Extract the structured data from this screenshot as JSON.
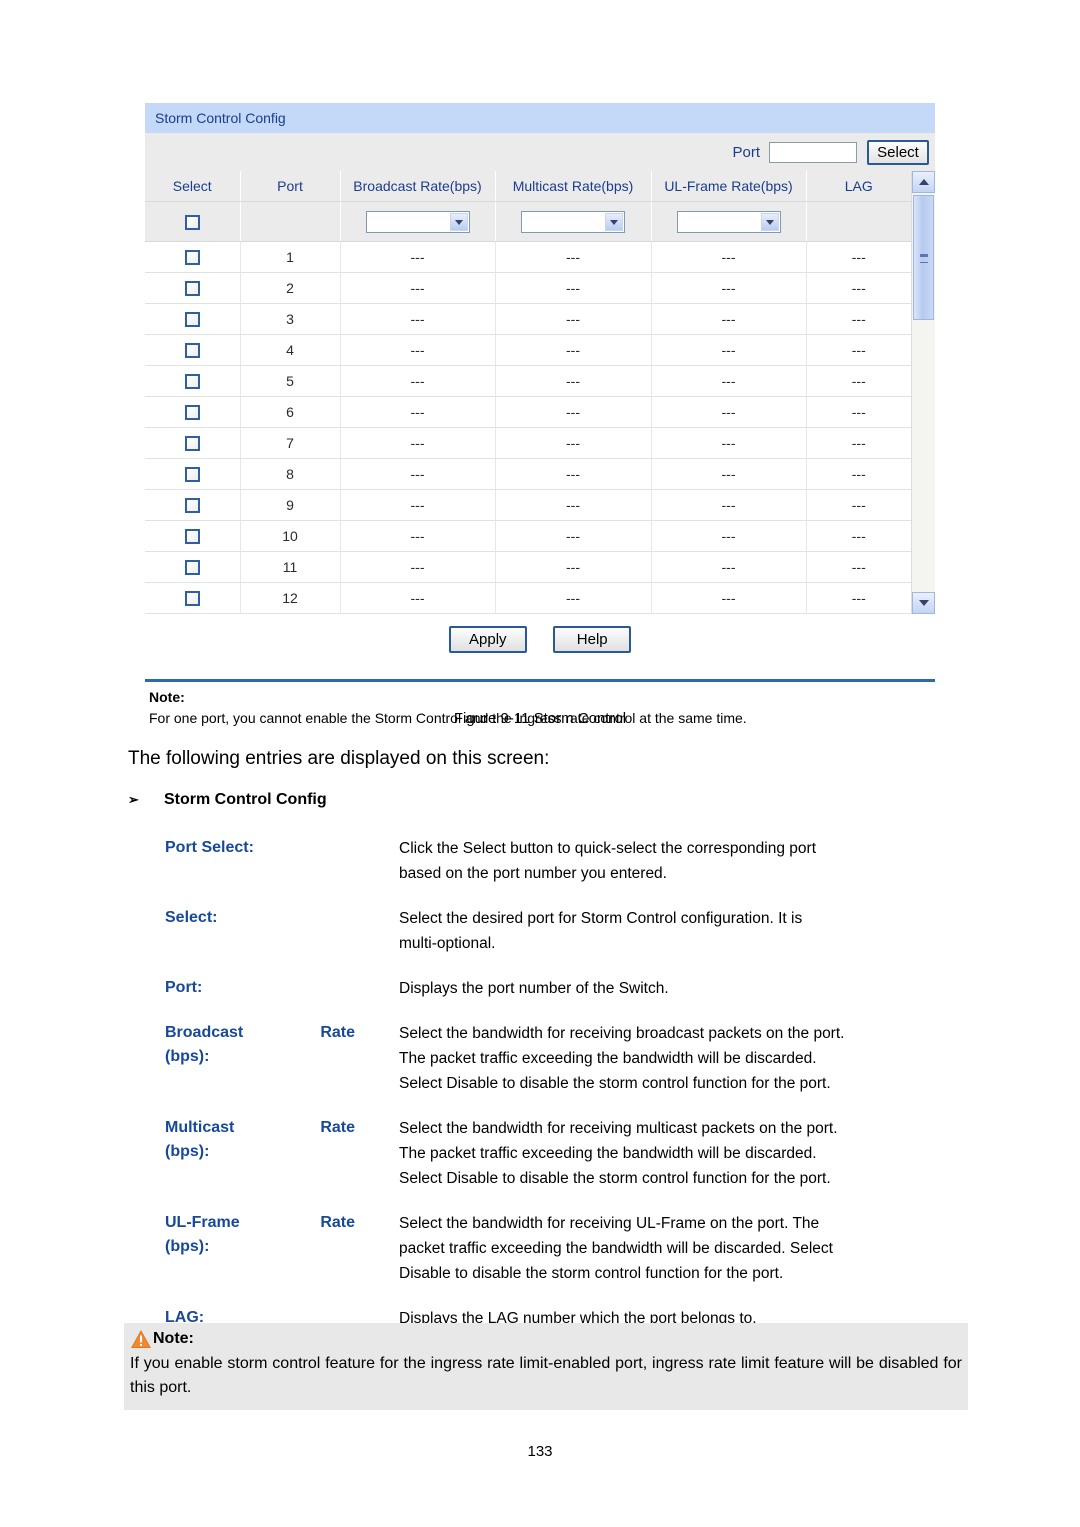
{
  "screenshot": {
    "title": "Storm Control Config",
    "filter": {
      "port_label": "Port",
      "port_value": "",
      "port_placeholder": "",
      "select_button": "Select"
    },
    "columns": [
      "Select",
      "Port",
      "Broadcast Rate(bps)",
      "Multicast Rate(bps)",
      "UL-Frame Rate(bps)",
      "LAG"
    ],
    "filter_row": {
      "checkbox_checked": false,
      "broadcast_rate": "",
      "multicast_rate": "",
      "ul_frame_rate": ""
    },
    "rows": [
      {
        "port": "1",
        "broadcast": "---",
        "multicast": "---",
        "ul_frame": "---",
        "lag": "---"
      },
      {
        "port": "2",
        "broadcast": "---",
        "multicast": "---",
        "ul_frame": "---",
        "lag": "---"
      },
      {
        "port": "3",
        "broadcast": "---",
        "multicast": "---",
        "ul_frame": "---",
        "lag": "---"
      },
      {
        "port": "4",
        "broadcast": "---",
        "multicast": "---",
        "ul_frame": "---",
        "lag": "---"
      },
      {
        "port": "5",
        "broadcast": "---",
        "multicast": "---",
        "ul_frame": "---",
        "lag": "---"
      },
      {
        "port": "6",
        "broadcast": "---",
        "multicast": "---",
        "ul_frame": "---",
        "lag": "---"
      },
      {
        "port": "7",
        "broadcast": "---",
        "multicast": "---",
        "ul_frame": "---",
        "lag": "---"
      },
      {
        "port": "8",
        "broadcast": "---",
        "multicast": "---",
        "ul_frame": "---",
        "lag": "---"
      },
      {
        "port": "9",
        "broadcast": "---",
        "multicast": "---",
        "ul_frame": "---",
        "lag": "---"
      },
      {
        "port": "10",
        "broadcast": "---",
        "multicast": "---",
        "ul_frame": "---",
        "lag": "---"
      },
      {
        "port": "11",
        "broadcast": "---",
        "multicast": "---",
        "ul_frame": "---",
        "lag": "---"
      },
      {
        "port": "12",
        "broadcast": "---",
        "multicast": "---",
        "ul_frame": "---",
        "lag": "---"
      }
    ],
    "buttons": {
      "apply": "Apply",
      "help": "Help"
    },
    "note": {
      "title": "Note:",
      "text": "For one port, you cannot enable the Storm Control and the Ingress rate control at the same time."
    },
    "icons": {
      "scroll_up": "chevron-up-icon",
      "scroll_down": "chevron-down-icon",
      "dropdown": "chevron-down-icon"
    }
  },
  "document": {
    "figure_caption": "Figure 9-11 Storm Control",
    "intro": "The following entries are displayed on this screen:",
    "section_bullet": "➢",
    "section_title": "Storm Control Config",
    "entries": [
      {
        "term": "Port Select:",
        "term_left": "",
        "term_right": "",
        "lines": [
          "Click the Select button to quick-select the corresponding port",
          "based on the port number you entered."
        ]
      },
      {
        "term": "Select:",
        "term_left": "",
        "term_right": "",
        "lines": [
          "Select the desired port for Storm Control configuration. It is",
          "multi-optional."
        ]
      },
      {
        "term": "Port:",
        "term_left": "",
        "term_right": "",
        "lines": [
          "Displays the port number of the Switch."
        ]
      },
      {
        "term": "",
        "term_left": "Broadcast",
        "term_right": "Rate",
        "term_line2": "(bps):",
        "lines": [
          "Select the bandwidth for receiving broadcast packets on the port.",
          "The packet traffic exceeding the bandwidth will be discarded.",
          "Select Disable to disable the storm control function for the port."
        ]
      },
      {
        "term": "",
        "term_left": "Multicast",
        "term_right": "Rate",
        "term_line2": "(bps):",
        "lines": [
          "Select the bandwidth for receiving multicast packets on the port.",
          "The packet traffic exceeding the bandwidth will be discarded.",
          "Select Disable to disable the storm control function for the port."
        ]
      },
      {
        "term": "",
        "term_left": "UL-Frame",
        "term_right": "Rate",
        "term_line2": "(bps):",
        "lines": [
          "Select the bandwidth for receiving UL-Frame on the port. The",
          "packet traffic exceeding the bandwidth will be discarded. Select",
          "Disable to disable the storm control function for the port."
        ]
      },
      {
        "term": "LAG:",
        "term_left": "",
        "term_right": "",
        "lines": [
          "Displays the LAG number which the port belongs to."
        ]
      }
    ],
    "note_box": {
      "icon": "warning-triangle-icon",
      "title": "Note:",
      "line1": "If you enable storm control feature for the ingress rate limit-enabled port, ingress rate limit feature",
      "line2": "will be disabled for this port."
    },
    "page_number": "133"
  },
  "colors": {
    "titlebar_bg": "#c3d9f7",
    "header_text": "#1b3d8f",
    "term_blue": "#16499c",
    "rule_blue": "#2a6ca8",
    "warning_orange": "#e8761f",
    "note_box_bg": "#e8e8e8"
  }
}
